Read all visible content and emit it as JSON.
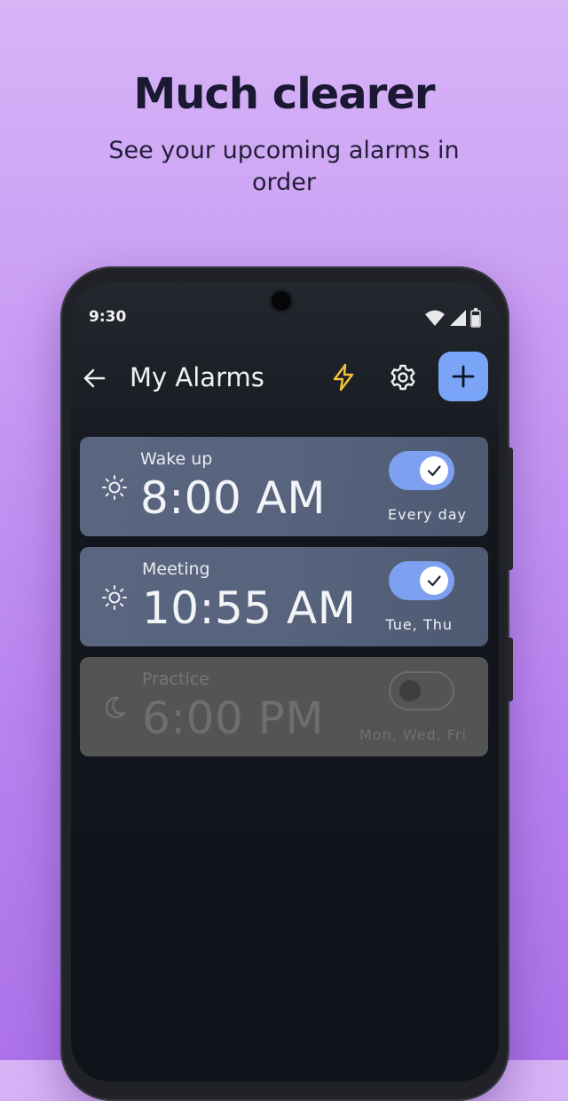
{
  "promo": {
    "headline": "Much clearer",
    "subhead": "See your upcoming alarms in order"
  },
  "status_bar": {
    "time": "9:30",
    "icons": [
      "wifi-icon",
      "signal-icon",
      "battery-icon"
    ]
  },
  "app_bar": {
    "title": "My Alarms",
    "icons": [
      "back-arrow-icon",
      "lightning-bolt-icon",
      "gear-icon",
      "plus-icon"
    ]
  },
  "alarms": [
    {
      "label": "Wake up",
      "time": "8:00 AM",
      "days": "Every day",
      "enabled": true,
      "icon": "sun-icon"
    },
    {
      "label": "Meeting",
      "time": "10:55 AM",
      "days": "Tue, Thu",
      "enabled": true,
      "icon": "sun-icon"
    },
    {
      "label": "Practice",
      "time": "6:00 PM",
      "days": "Mon, Wed, Fri",
      "enabled": false,
      "icon": "moon-icon"
    }
  ],
  "colors": {
    "accent": "#7aa4f7",
    "bolt": "#f4c43a",
    "card_on": "#58647e",
    "card_off": "#545454"
  }
}
